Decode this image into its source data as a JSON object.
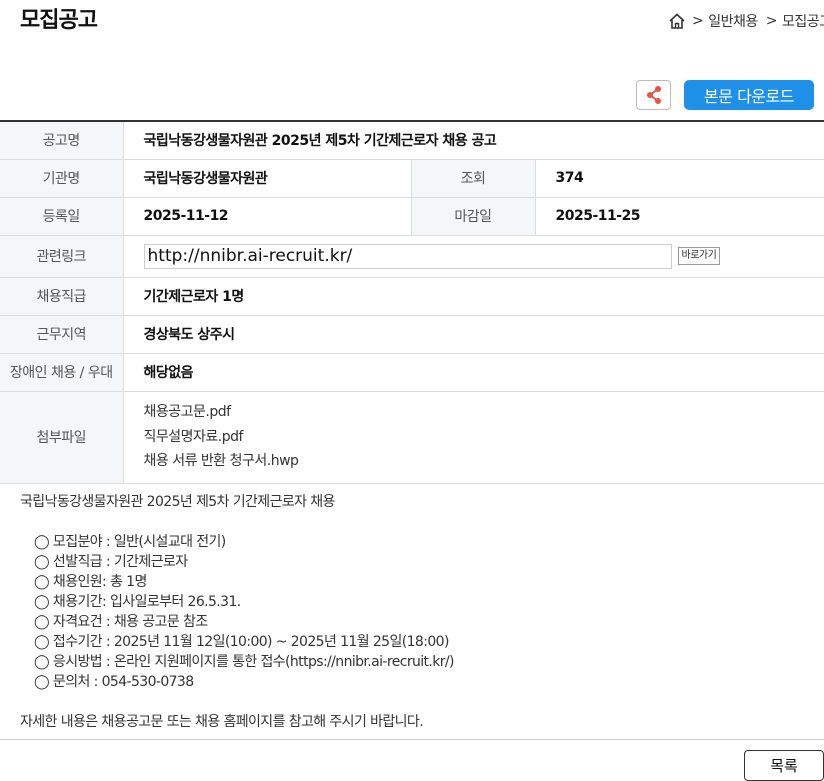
{
  "page_title": "모집공고",
  "breadcrumb": {
    "sep1": ">",
    "crumb1": "일반채용",
    "sep2": ">",
    "crumb2": "모집공고"
  },
  "toolbar": {
    "download_label": "본문 다운로드"
  },
  "table": {
    "title_label": "공고명",
    "title_value": "국립낙동강생물자원관 2025년 제5차 기간제근로자 채용 공고",
    "org_label": "기관명",
    "org_value": "국립낙동강생물자원관",
    "views_label": "조회",
    "views_value": "374",
    "reg_label": "등록일",
    "reg_value": "2025-11-12",
    "deadline_label": "마감일",
    "deadline_value": "2025-11-25",
    "link_label": "관련링크",
    "link_value": "http://nnibr.ai-recruit.kr/",
    "go_label": "바로가기",
    "position_label": "채용직급",
    "position_value": "기간제근로자 1명",
    "location_label": "근무지역",
    "location_value": "경상북도 상주시",
    "disability_label": "장애인 채용 / 우대",
    "disability_value": "해당없음",
    "files_label": "첨부파일",
    "files": [
      "채용공고문.pdf",
      "직무설명자료.pdf",
      "채용 서류 반환 청구서.hwp"
    ]
  },
  "body": {
    "heading": "국립낙동강생물자원관 2025년 제5차 기간제근로자 채용",
    "items": [
      "◯ 모집분야 : 일반(시설교대 전기)",
      "◯ 선발직급 : 기간제근로자",
      "◯ 채용인원: 총 1명",
      "◯ 채용기간: 입사일로부터 26.5.31.",
      "◯ 자격요건 : 채용 공고문 참조",
      "◯ 접수기간 : 2025년 11월 12일(10:00) ~ 2025년 11월 25일(18:00)",
      "◯ 응시방법 : 온라인 지원페이지를 통한 접수(https://nnibr.ai-recruit.kr/)",
      "◯ 문의처 : 054-530-0738"
    ],
    "footer": "자세한 내용은 채용공고문 또는 채용 홈페이지를 참고해 주시기 바랍니다."
  },
  "list_button": "목록",
  "colors": {
    "accent": "#1e90e8",
    "header_bg": "#f3f7fa"
  }
}
